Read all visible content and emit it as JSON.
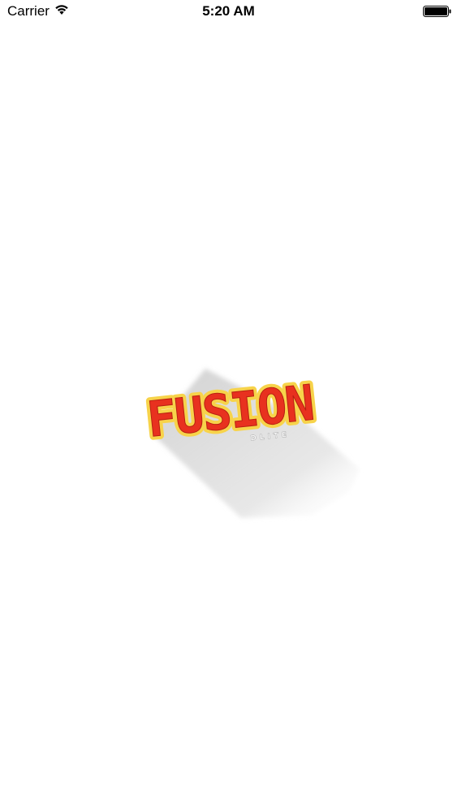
{
  "status_bar": {
    "carrier": "Carrier",
    "time": "5:20 AM",
    "wifi_icon": "wifi-icon",
    "battery_icon": "battery-icon"
  },
  "splash": {
    "logo_text": "FUSION",
    "logo_subtext": "DLITE",
    "colors": {
      "logo_red": "#e8311f",
      "logo_yellow": "#f7d34a",
      "shadow": "#d9d9d9",
      "background": "#ffffff"
    }
  }
}
